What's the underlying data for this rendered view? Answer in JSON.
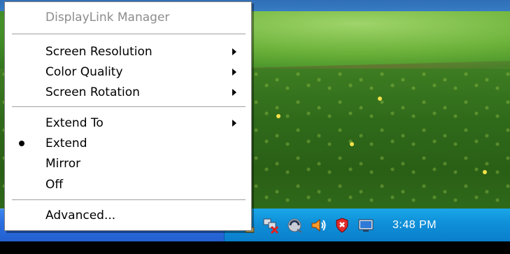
{
  "menu": {
    "header": "DisplayLink Manager",
    "groups": [
      [
        {
          "label": "Screen Resolution",
          "submenu": true
        },
        {
          "label": "Color Quality",
          "submenu": true
        },
        {
          "label": "Screen Rotation",
          "submenu": true
        }
      ],
      [
        {
          "label": "Extend To",
          "submenu": true
        },
        {
          "label": "Extend",
          "selected": true
        },
        {
          "label": "Mirror"
        },
        {
          "label": "Off"
        }
      ],
      [
        {
          "label": "Advanced..."
        }
      ]
    ]
  },
  "taskbar": {
    "clock": "3:48 PM",
    "tray_icons": [
      "network-icon",
      "network-disconnected-icon",
      "displaylink-icon",
      "volume-icon",
      "security-shield-icon",
      "monitor-icon"
    ]
  },
  "colors": {
    "taskbar_blue": "#2a6fe0",
    "tray_blue": "#0f8fd8",
    "menu_header_gray": "#8c8c8c"
  }
}
